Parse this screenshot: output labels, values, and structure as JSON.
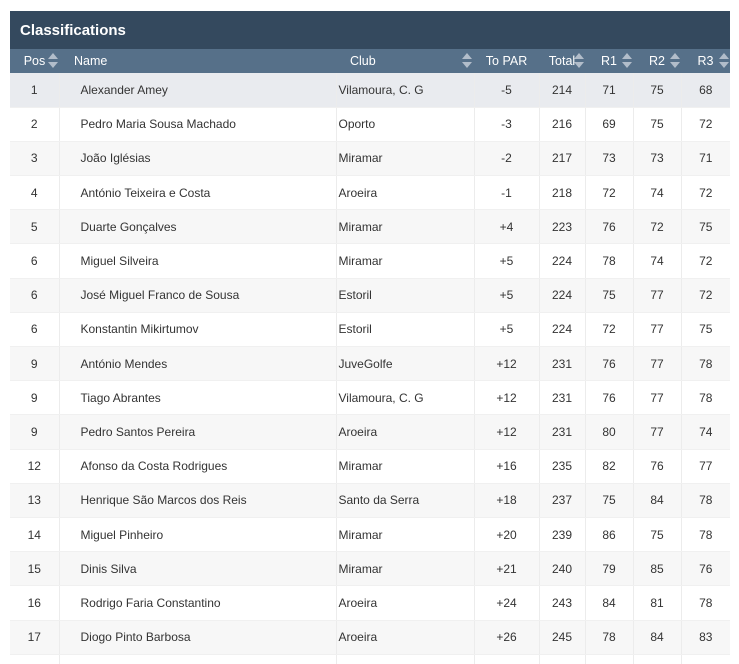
{
  "panel": {
    "title": "Classifications"
  },
  "columns": {
    "pos": "Pos",
    "name": "Name",
    "club": "Club",
    "to_par": "To PAR",
    "total": "Total",
    "r1": "R1",
    "r2": "R2",
    "r3": "R3"
  },
  "rows": [
    {
      "pos": "1",
      "name": "Alexander Amey",
      "club": "Vilamoura, C. G",
      "to_par": "-5",
      "total": "214",
      "r1": "71",
      "r2": "75",
      "r3": "68"
    },
    {
      "pos": "2",
      "name": "Pedro Maria Sousa Machado",
      "club": "Oporto",
      "to_par": "-3",
      "total": "216",
      "r1": "69",
      "r2": "75",
      "r3": "72"
    },
    {
      "pos": "3",
      "name": "João Iglésias",
      "club": "Miramar",
      "to_par": "-2",
      "total": "217",
      "r1": "73",
      "r2": "73",
      "r3": "71"
    },
    {
      "pos": "4",
      "name": "António Teixeira e Costa",
      "club": "Aroeira",
      "to_par": "-1",
      "total": "218",
      "r1": "72",
      "r2": "74",
      "r3": "72"
    },
    {
      "pos": "5",
      "name": "Duarte Gonçalves",
      "club": "Miramar",
      "to_par": "+4",
      "total": "223",
      "r1": "76",
      "r2": "72",
      "r3": "75"
    },
    {
      "pos": "6",
      "name": "Miguel Silveira",
      "club": "Miramar",
      "to_par": "+5",
      "total": "224",
      "r1": "78",
      "r2": "74",
      "r3": "72"
    },
    {
      "pos": "6",
      "name": "José Miguel Franco de Sousa",
      "club": "Estoril",
      "to_par": "+5",
      "total": "224",
      "r1": "75",
      "r2": "77",
      "r3": "72"
    },
    {
      "pos": "6",
      "name": "Konstantin Mikirtumov",
      "club": "Estoril",
      "to_par": "+5",
      "total": "224",
      "r1": "72",
      "r2": "77",
      "r3": "75"
    },
    {
      "pos": "9",
      "name": "António Mendes",
      "club": "JuveGolfe",
      "to_par": "+12",
      "total": "231",
      "r1": "76",
      "r2": "77",
      "r3": "78"
    },
    {
      "pos": "9",
      "name": "Tiago Abrantes",
      "club": "Vilamoura, C. G",
      "to_par": "+12",
      "total": "231",
      "r1": "76",
      "r2": "77",
      "r3": "78"
    },
    {
      "pos": "9",
      "name": "Pedro Santos Pereira",
      "club": "Aroeira",
      "to_par": "+12",
      "total": "231",
      "r1": "80",
      "r2": "77",
      "r3": "74"
    },
    {
      "pos": "12",
      "name": "Afonso da Costa Rodrigues",
      "club": "Miramar",
      "to_par": "+16",
      "total": "235",
      "r1": "82",
      "r2": "76",
      "r3": "77"
    },
    {
      "pos": "13",
      "name": "Henrique São Marcos dos Reis",
      "club": "Santo da Serra",
      "to_par": "+18",
      "total": "237",
      "r1": "75",
      "r2": "84",
      "r3": "78"
    },
    {
      "pos": "14",
      "name": "Miguel Pinheiro",
      "club": "Miramar",
      "to_par": "+20",
      "total": "239",
      "r1": "86",
      "r2": "75",
      "r3": "78"
    },
    {
      "pos": "15",
      "name": "Dinis Silva",
      "club": "Miramar",
      "to_par": "+21",
      "total": "240",
      "r1": "79",
      "r2": "85",
      "r3": "76"
    },
    {
      "pos": "16",
      "name": "Rodrigo Faria Constantino",
      "club": "Aroeira",
      "to_par": "+24",
      "total": "243",
      "r1": "84",
      "r2": "81",
      "r3": "78"
    },
    {
      "pos": "17",
      "name": "Diogo Pinto Barbosa",
      "club": "Aroeira",
      "to_par": "+26",
      "total": "245",
      "r1": "78",
      "r2": "84",
      "r3": "83"
    },
    {
      "pos": "",
      "name": "",
      "club": "",
      "to_par": "",
      "total": "",
      "r1": "",
      "r2": "",
      "r3": ""
    }
  ],
  "icons": {
    "sort": "sort-both-icon"
  },
  "colors": {
    "title_bg": "#34495e",
    "header_bg": "#567089",
    "highlight_row": "#e9ebef",
    "sort_arrows": "#b2bdca"
  }
}
